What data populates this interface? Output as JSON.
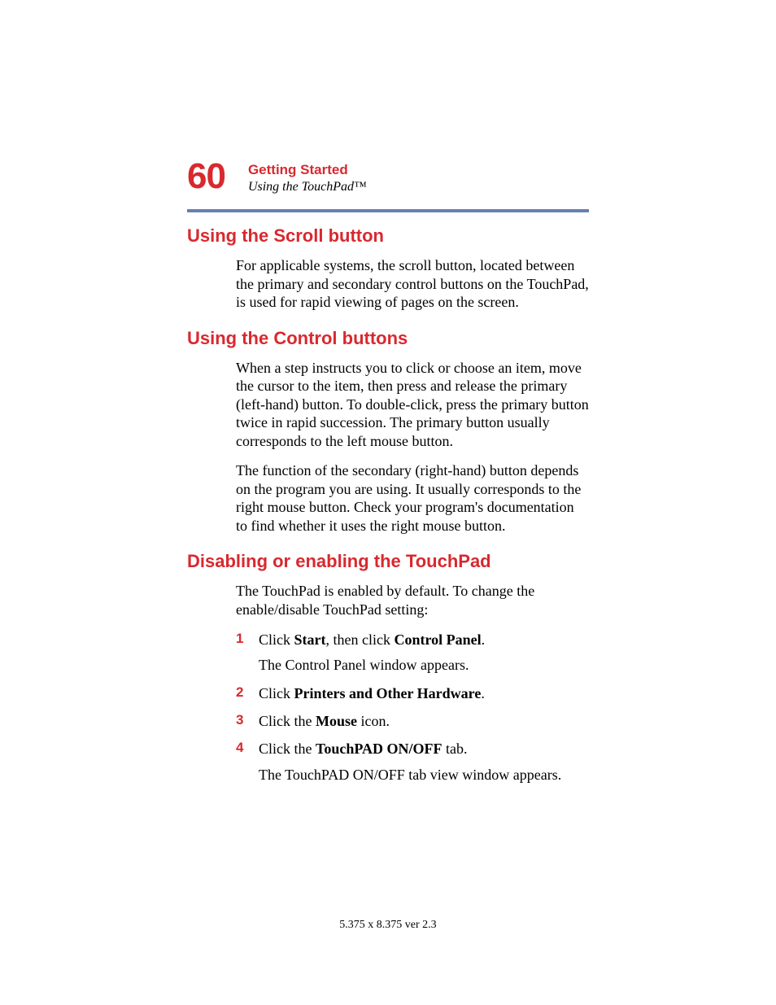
{
  "page_number": "60",
  "chapter_title": "Getting Started",
  "section_subtitle": "Using the TouchPad™",
  "sections": [
    {
      "heading": "Using the Scroll button",
      "paragraphs": [
        "For applicable systems, the scroll button, located between the primary and secondary control buttons on the TouchPad, is used for rapid viewing of pages on the screen."
      ]
    },
    {
      "heading": "Using the Control buttons",
      "paragraphs": [
        "When a step instructs you to click or choose an item, move the cursor to the item, then press and release the primary (left-hand) button. To double-click, press the primary button twice in rapid succession. The primary button usually corresponds to the left mouse button.",
        "The function of the secondary (right-hand) button depends on the program you are using. It usually corresponds to the right mouse button. Check your program's documentation to find whether it uses the right mouse button."
      ]
    },
    {
      "heading": "Disabling or enabling the TouchPad",
      "paragraphs": [
        "The TouchPad is enabled by default. To change the enable/disable TouchPad setting:"
      ]
    }
  ],
  "steps": [
    {
      "num": "1",
      "pre1": "Click ",
      "b1": "Start",
      "mid": ", then click ",
      "b2": "Control Panel",
      "post": ".",
      "follow": "The Control Panel window appears."
    },
    {
      "num": "2",
      "pre1": "Click ",
      "b1": "Printers and Other Hardware",
      "mid": "",
      "b2": "",
      "post": "."
    },
    {
      "num": "3",
      "pre1": "Click the ",
      "b1": "Mouse",
      "mid": "",
      "b2": "",
      "post": " icon."
    },
    {
      "num": "4",
      "pre1": "Click the ",
      "b1": "TouchPAD ON/OFF",
      "mid": "",
      "b2": "",
      "post": " tab.",
      "follow": "The TouchPAD ON/OFF tab view window appears."
    }
  ],
  "footer": "5.375 x 8.375 ver 2.3"
}
